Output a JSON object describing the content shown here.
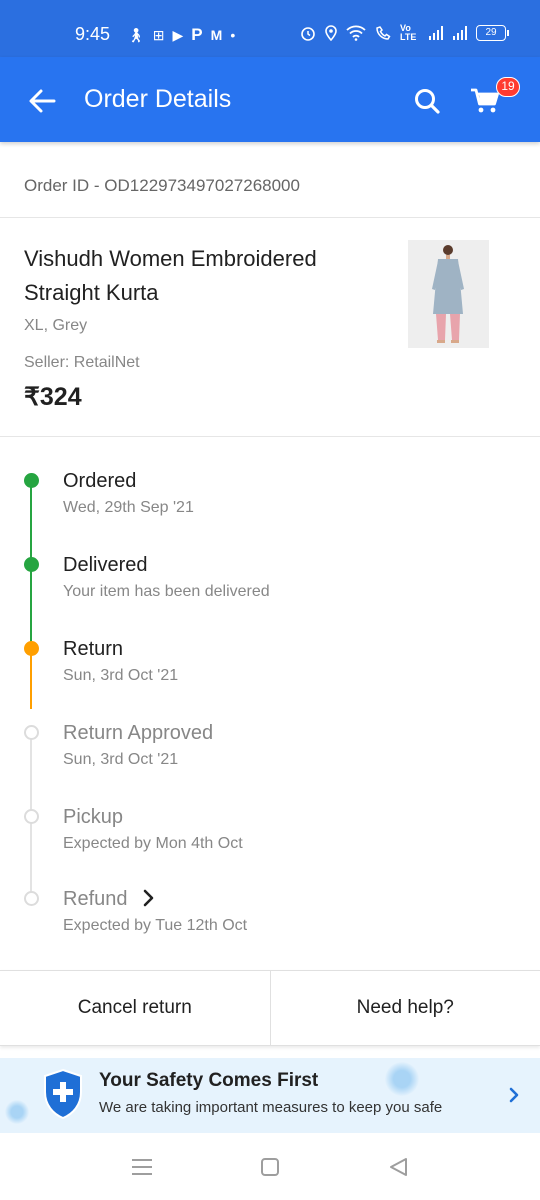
{
  "status_bar": {
    "time": "9:45",
    "battery": "29",
    "network_label": "Vo LTE"
  },
  "app_bar": {
    "title": "Order Details",
    "cart_count": "19",
    "background_color": "#2874f0"
  },
  "order": {
    "id_text": "Order ID - OD122973497027268000"
  },
  "product": {
    "title": "Vishudh Women Embroidered Straight Kurta",
    "variant": "XL, Grey",
    "seller": "Seller: RetailNet",
    "price": "₹324"
  },
  "timeline": [
    {
      "title": "Ordered",
      "subtitle": "Wed, 29th Sep '21",
      "state": "done"
    },
    {
      "title": "Delivered",
      "subtitle": "Your item has been delivered",
      "state": "done"
    },
    {
      "title": "Return",
      "subtitle": "Sun, 3rd Oct '21",
      "state": "current"
    },
    {
      "title": "Return Approved",
      "subtitle": "Sun, 3rd Oct '21",
      "state": "pending"
    },
    {
      "title": "Pickup",
      "subtitle": "Expected by Mon 4th Oct",
      "state": "pending"
    },
    {
      "title": "Refund",
      "subtitle": "Expected by Tue 12th Oct",
      "state": "pending"
    }
  ],
  "actions": {
    "cancel_return": "Cancel return",
    "need_help": "Need help?"
  },
  "safety_banner": {
    "title": "Your Safety Comes First",
    "subtitle": "We are taking important measures to keep you safe"
  },
  "colors": {
    "done": "#26a541",
    "current": "#ff9f00",
    "pending": "#dcdcdc"
  }
}
